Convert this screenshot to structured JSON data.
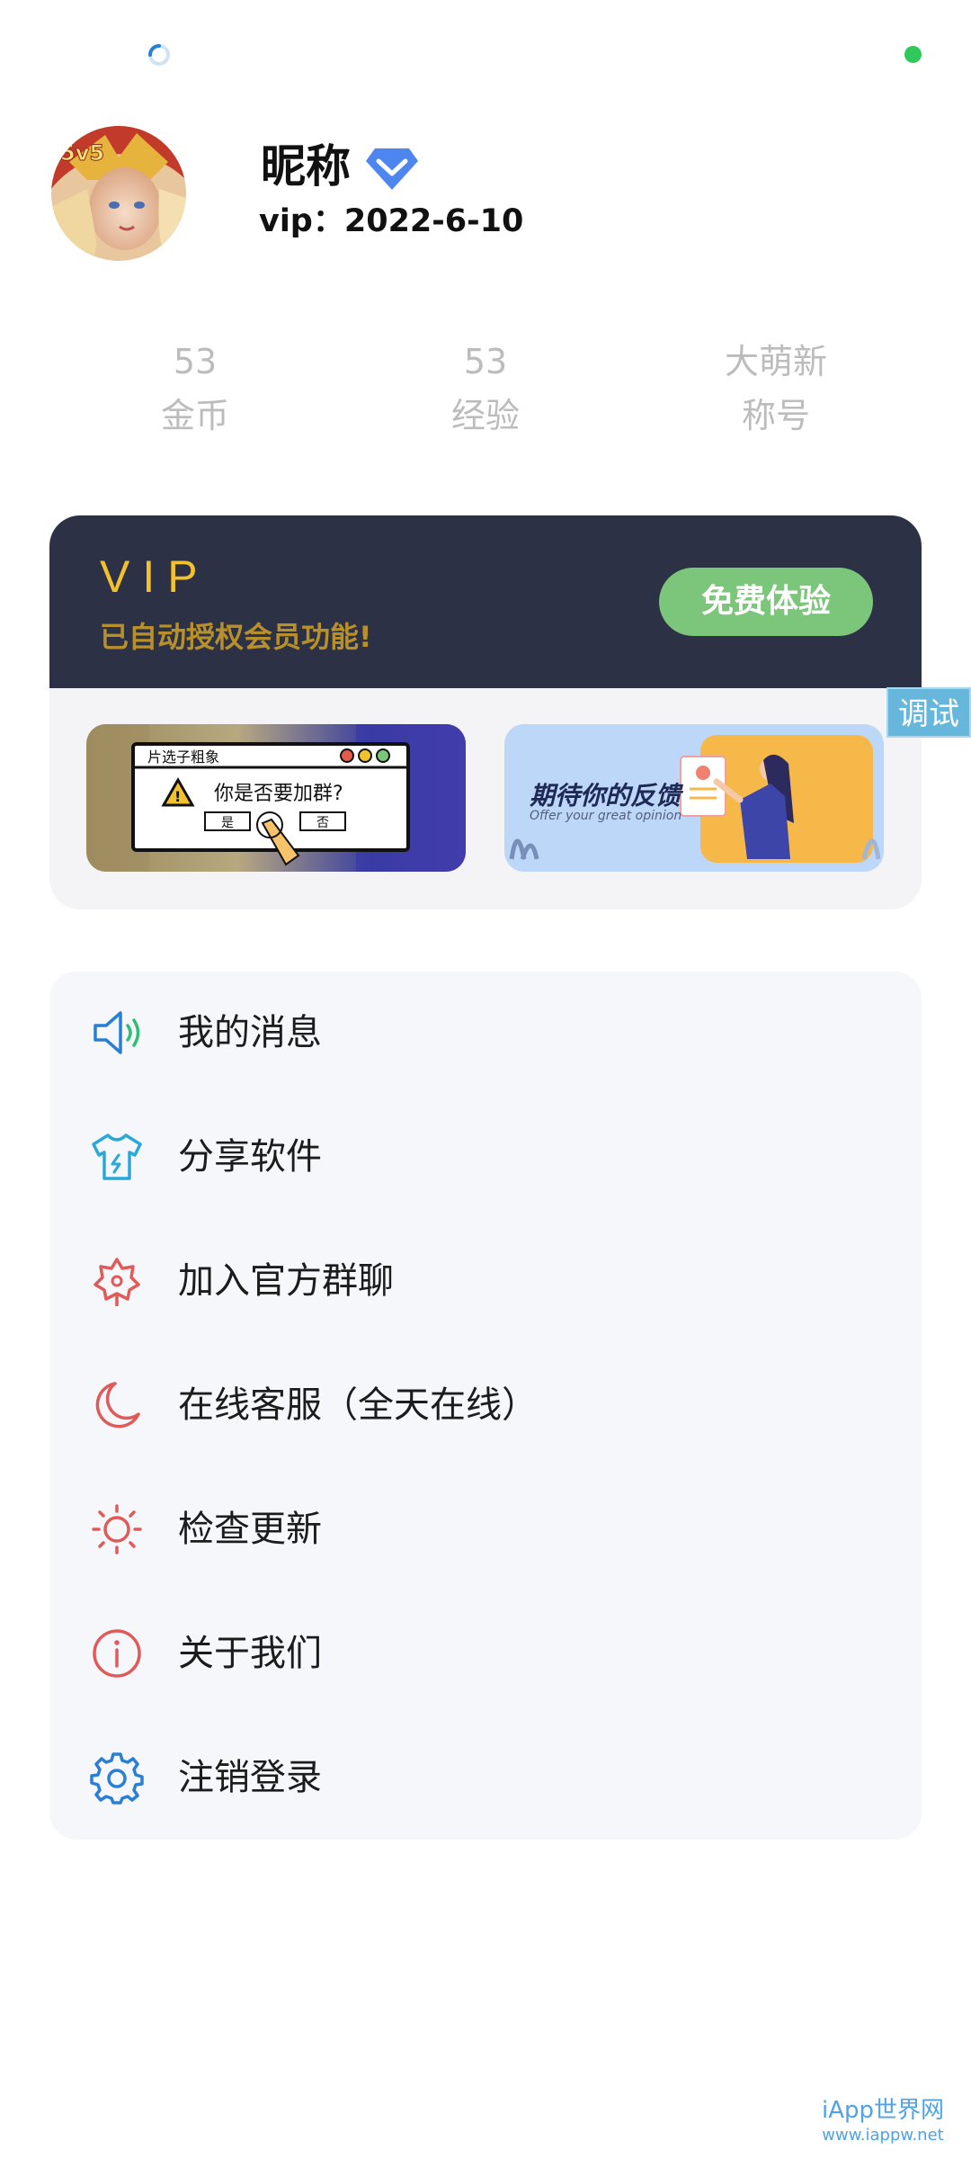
{
  "profile": {
    "nickname": "昵称",
    "vip_date": "vip：2022-6-10"
  },
  "stats": [
    {
      "value": "53",
      "label": "金币"
    },
    {
      "value": "53",
      "label": "经验"
    },
    {
      "value": "大萌新",
      "label": "称号"
    }
  ],
  "vip_card": {
    "title": "VIP",
    "subtitle": "已自动授权会员功能!",
    "trial_button": "免费体验"
  },
  "banners": {
    "left": {
      "header": "片选子粗象",
      "question": "你是否要加群?",
      "yes": "是",
      "no": "否"
    },
    "right": {
      "title": "期待你的反馈",
      "subtitle": "Offer your great opinion"
    }
  },
  "debug_tag": "调试",
  "menu": [
    {
      "label": "我的消息",
      "icon": "speaker-icon"
    },
    {
      "label": "分享软件",
      "icon": "tshirt-icon"
    },
    {
      "label": "加入官方群聊",
      "icon": "flower-icon"
    },
    {
      "label": "在线客服（全天在线）",
      "icon": "moon-icon"
    },
    {
      "label": "检查更新",
      "icon": "sun-icon"
    },
    {
      "label": "关于我们",
      "icon": "info-icon"
    },
    {
      "label": "注销登录",
      "icon": "gear-icon"
    }
  ],
  "watermark": {
    "line1": "iApp世界网",
    "line2": "www.iappw.net"
  },
  "colors": {
    "vip_header_bg": "#2d3145",
    "vip_gold": "#f2c12e",
    "trial_green": "#7cc67b",
    "accent_blue": "#2a7fd4",
    "icon_red": "#e05a5a",
    "status_green": "#2fc85b"
  }
}
